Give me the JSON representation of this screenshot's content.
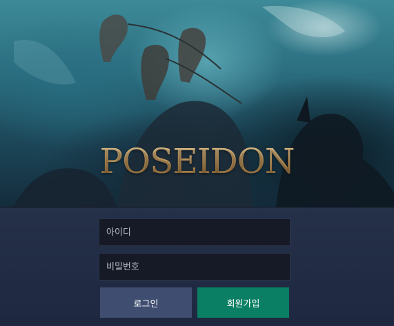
{
  "hero": {
    "logo_text": "POSEIDON"
  },
  "login_form": {
    "id_placeholder": "아이디",
    "password_placeholder": "비밀번호",
    "login_label": "로그인",
    "signup_label": "회원가입"
  },
  "colors": {
    "panel_bg": "#232d45",
    "input_bg": "#151a26",
    "login_button": "#3f4d70",
    "signup_button": "#0b7f64",
    "logo_gold": "#d9b376"
  }
}
